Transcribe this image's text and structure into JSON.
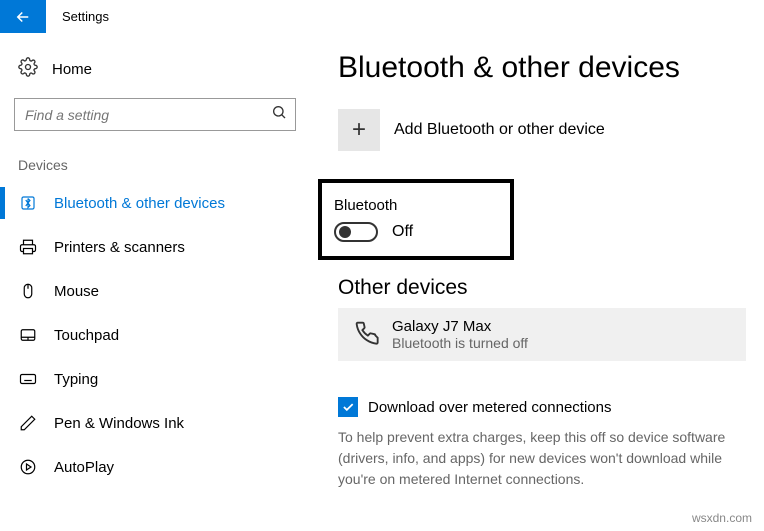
{
  "header": {
    "appTitle": "Settings"
  },
  "sidebar": {
    "homeLabel": "Home",
    "searchPlaceholder": "Find a setting",
    "sectionTitle": "Devices",
    "items": [
      {
        "label": "Bluetooth & other devices"
      },
      {
        "label": "Printers & scanners"
      },
      {
        "label": "Mouse"
      },
      {
        "label": "Touchpad"
      },
      {
        "label": "Typing"
      },
      {
        "label": "Pen & Windows Ink"
      },
      {
        "label": "AutoPlay"
      }
    ]
  },
  "main": {
    "title": "Bluetooth & other devices",
    "addDeviceLabel": "Add Bluetooth or other device",
    "bluetoothLabel": "Bluetooth",
    "bluetoothState": "Off",
    "otherDevicesTitle": "Other devices",
    "device": {
      "name": "Galaxy J7 Max",
      "status": "Bluetooth is turned off"
    },
    "meteredLabel": "Download over metered connections",
    "meteredHelp": "To help prevent extra charges, keep this off so device software (drivers, info, and apps) for new devices won't download while you're on metered Internet connections."
  },
  "watermark": "wsxdn.com"
}
